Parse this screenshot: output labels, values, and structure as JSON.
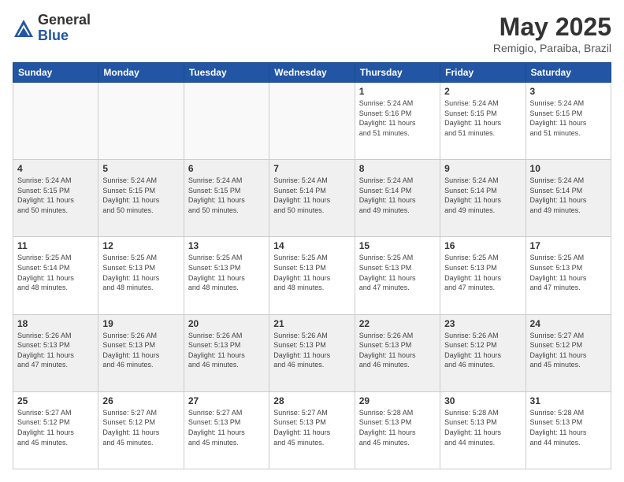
{
  "header": {
    "logo_general": "General",
    "logo_blue": "Blue",
    "month_title": "May 2025",
    "location": "Remigio, Paraiba, Brazil"
  },
  "days_of_week": [
    "Sunday",
    "Monday",
    "Tuesday",
    "Wednesday",
    "Thursday",
    "Friday",
    "Saturday"
  ],
  "weeks": [
    {
      "shaded": false,
      "days": [
        {
          "num": "",
          "info": "",
          "empty": true
        },
        {
          "num": "",
          "info": "",
          "empty": true
        },
        {
          "num": "",
          "info": "",
          "empty": true
        },
        {
          "num": "",
          "info": "",
          "empty": true
        },
        {
          "num": "1",
          "info": "Sunrise: 5:24 AM\nSunset: 5:16 PM\nDaylight: 11 hours\nand 51 minutes.",
          "empty": false
        },
        {
          "num": "2",
          "info": "Sunrise: 5:24 AM\nSunset: 5:15 PM\nDaylight: 11 hours\nand 51 minutes.",
          "empty": false
        },
        {
          "num": "3",
          "info": "Sunrise: 5:24 AM\nSunset: 5:15 PM\nDaylight: 11 hours\nand 51 minutes.",
          "empty": false
        }
      ]
    },
    {
      "shaded": true,
      "days": [
        {
          "num": "4",
          "info": "Sunrise: 5:24 AM\nSunset: 5:15 PM\nDaylight: 11 hours\nand 50 minutes.",
          "empty": false
        },
        {
          "num": "5",
          "info": "Sunrise: 5:24 AM\nSunset: 5:15 PM\nDaylight: 11 hours\nand 50 minutes.",
          "empty": false
        },
        {
          "num": "6",
          "info": "Sunrise: 5:24 AM\nSunset: 5:15 PM\nDaylight: 11 hours\nand 50 minutes.",
          "empty": false
        },
        {
          "num": "7",
          "info": "Sunrise: 5:24 AM\nSunset: 5:14 PM\nDaylight: 11 hours\nand 50 minutes.",
          "empty": false
        },
        {
          "num": "8",
          "info": "Sunrise: 5:24 AM\nSunset: 5:14 PM\nDaylight: 11 hours\nand 49 minutes.",
          "empty": false
        },
        {
          "num": "9",
          "info": "Sunrise: 5:24 AM\nSunset: 5:14 PM\nDaylight: 11 hours\nand 49 minutes.",
          "empty": false
        },
        {
          "num": "10",
          "info": "Sunrise: 5:24 AM\nSunset: 5:14 PM\nDaylight: 11 hours\nand 49 minutes.",
          "empty": false
        }
      ]
    },
    {
      "shaded": false,
      "days": [
        {
          "num": "11",
          "info": "Sunrise: 5:25 AM\nSunset: 5:14 PM\nDaylight: 11 hours\nand 48 minutes.",
          "empty": false
        },
        {
          "num": "12",
          "info": "Sunrise: 5:25 AM\nSunset: 5:13 PM\nDaylight: 11 hours\nand 48 minutes.",
          "empty": false
        },
        {
          "num": "13",
          "info": "Sunrise: 5:25 AM\nSunset: 5:13 PM\nDaylight: 11 hours\nand 48 minutes.",
          "empty": false
        },
        {
          "num": "14",
          "info": "Sunrise: 5:25 AM\nSunset: 5:13 PM\nDaylight: 11 hours\nand 48 minutes.",
          "empty": false
        },
        {
          "num": "15",
          "info": "Sunrise: 5:25 AM\nSunset: 5:13 PM\nDaylight: 11 hours\nand 47 minutes.",
          "empty": false
        },
        {
          "num": "16",
          "info": "Sunrise: 5:25 AM\nSunset: 5:13 PM\nDaylight: 11 hours\nand 47 minutes.",
          "empty": false
        },
        {
          "num": "17",
          "info": "Sunrise: 5:25 AM\nSunset: 5:13 PM\nDaylight: 11 hours\nand 47 minutes.",
          "empty": false
        }
      ]
    },
    {
      "shaded": true,
      "days": [
        {
          "num": "18",
          "info": "Sunrise: 5:26 AM\nSunset: 5:13 PM\nDaylight: 11 hours\nand 47 minutes.",
          "empty": false
        },
        {
          "num": "19",
          "info": "Sunrise: 5:26 AM\nSunset: 5:13 PM\nDaylight: 11 hours\nand 46 minutes.",
          "empty": false
        },
        {
          "num": "20",
          "info": "Sunrise: 5:26 AM\nSunset: 5:13 PM\nDaylight: 11 hours\nand 46 minutes.",
          "empty": false
        },
        {
          "num": "21",
          "info": "Sunrise: 5:26 AM\nSunset: 5:13 PM\nDaylight: 11 hours\nand 46 minutes.",
          "empty": false
        },
        {
          "num": "22",
          "info": "Sunrise: 5:26 AM\nSunset: 5:13 PM\nDaylight: 11 hours\nand 46 minutes.",
          "empty": false
        },
        {
          "num": "23",
          "info": "Sunrise: 5:26 AM\nSunset: 5:12 PM\nDaylight: 11 hours\nand 46 minutes.",
          "empty": false
        },
        {
          "num": "24",
          "info": "Sunrise: 5:27 AM\nSunset: 5:12 PM\nDaylight: 11 hours\nand 45 minutes.",
          "empty": false
        }
      ]
    },
    {
      "shaded": false,
      "days": [
        {
          "num": "25",
          "info": "Sunrise: 5:27 AM\nSunset: 5:12 PM\nDaylight: 11 hours\nand 45 minutes.",
          "empty": false
        },
        {
          "num": "26",
          "info": "Sunrise: 5:27 AM\nSunset: 5:12 PM\nDaylight: 11 hours\nand 45 minutes.",
          "empty": false
        },
        {
          "num": "27",
          "info": "Sunrise: 5:27 AM\nSunset: 5:13 PM\nDaylight: 11 hours\nand 45 minutes.",
          "empty": false
        },
        {
          "num": "28",
          "info": "Sunrise: 5:27 AM\nSunset: 5:13 PM\nDaylight: 11 hours\nand 45 minutes.",
          "empty": false
        },
        {
          "num": "29",
          "info": "Sunrise: 5:28 AM\nSunset: 5:13 PM\nDaylight: 11 hours\nand 45 minutes.",
          "empty": false
        },
        {
          "num": "30",
          "info": "Sunrise: 5:28 AM\nSunset: 5:13 PM\nDaylight: 11 hours\nand 44 minutes.",
          "empty": false
        },
        {
          "num": "31",
          "info": "Sunrise: 5:28 AM\nSunset: 5:13 PM\nDaylight: 11 hours\nand 44 minutes.",
          "empty": false
        }
      ]
    }
  ]
}
